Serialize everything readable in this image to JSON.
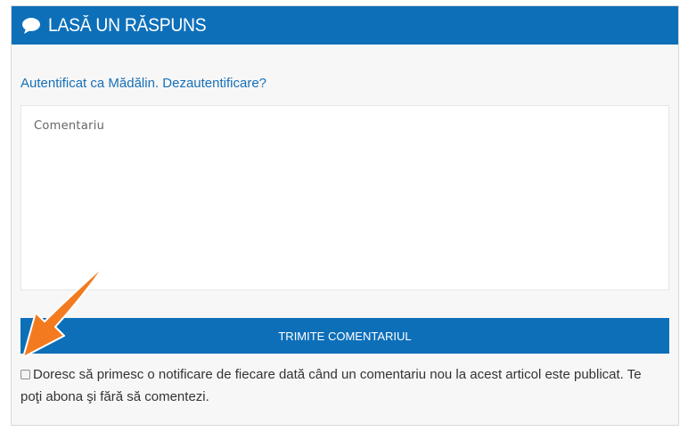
{
  "header": {
    "title": "LASĂ UN RĂSPUNS",
    "icon": "speech-bubble-icon",
    "background": "#0e6fb9"
  },
  "logged_in": {
    "prefix": "Autentificat ca Mădălin. ",
    "logout_link": "Dezautentificare?"
  },
  "comment": {
    "placeholder": "Comentariu",
    "value": ""
  },
  "submit": {
    "label": "TRIMITE COMENTARIUL"
  },
  "subscribe": {
    "checked": false,
    "label": "Doresc să primesc o notificare de fiecare dată când un comentariu nou la acest articol este publicat. Te poţi abona şi fără să comentezi."
  },
  "annotation": {
    "icon": "arrow-pointer-icon",
    "color": "#f47a20"
  }
}
